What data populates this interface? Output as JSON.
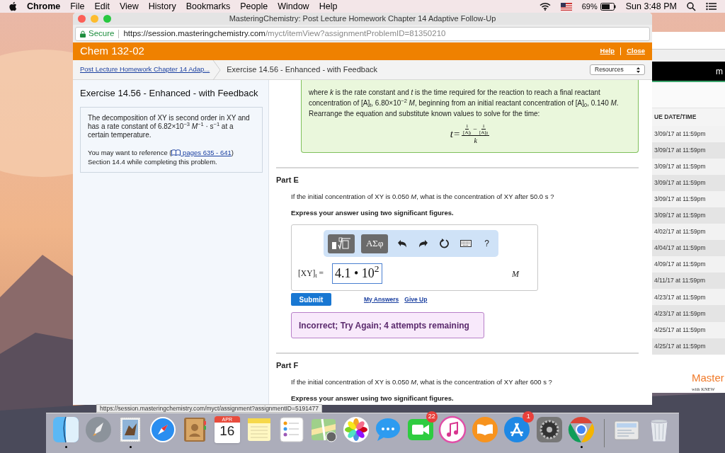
{
  "menu_bar": {
    "app": "Chrome",
    "menus": [
      "File",
      "Edit",
      "View",
      "History",
      "Bookmarks",
      "People",
      "Window",
      "Help"
    ],
    "battery": "69%",
    "clock": "Sun 3:48 PM"
  },
  "browser": {
    "title": "MasteringChemistry: Post Lecture Homework Chapter 14 Adaptive Follow-Up",
    "secure": "Secure",
    "url_host": "https://session.masteringchemistry.com",
    "url_path": "/myct/itemView?assignmentProblemID=81350210",
    "status_url": "https://session.masteringchemistry.com/myct/assignment?assignmentID=5191477"
  },
  "course_bar": {
    "title": "Chem 132-02",
    "links": [
      "Help",
      "Close"
    ]
  },
  "breadcrumb": {
    "parent": "Post Lecture Homework Chapter 14 Adap...",
    "current": "Exercise 14.56 - Enhanced - with Feedback",
    "resources": "Resources"
  },
  "sidebar": {
    "title": "Exercise 14.56 - Enhanced - with Feedback",
    "problem": "The decomposition of XY is second order in XY and has a rate constant of 6.82×10$^{−3}$ *M*$^{−1}$ · s$^{−1}$ at a certain temperature.",
    "reference_prefix": "You may want to reference (",
    "reference_link": "pages 635 - 641",
    "reference_suffix": ") Section 14.4 while completing this problem."
  },
  "hint": {
    "text": "where *k* is the rate constant and *t* is the time required for the reaction to reach a final reactant concentration of [A]$_{t}$, 6.80×10$^{−2}$ *M*, beginning from an initial reactant concentration of [A]$_{0}$, 0.140 *M*. Rearrange the equation and substitute known values to solve for the time:",
    "formula": {
      "lhs": "t=",
      "num1": "1",
      "den1": "[A]$_{t}$",
      "minus": "−",
      "num2": "1",
      "den2": "[A]$_{0}$",
      "den": "k"
    }
  },
  "parts": [
    {
      "title": "Part E",
      "question": "If the initial concentration of XY is 0.050 *M*, what is the concentration of XY after 50.0 s ?",
      "instruction": "Express your answer using two significant figures.",
      "answer": {
        "label": "[XY]$_{t}$ =",
        "value": "4.1 • 10$^{2}$",
        "unit": "M",
        "toolbar": [
          {
            "kind": "templates"
          },
          {
            "kind": "symbols",
            "label": "ΑΣφ"
          },
          {
            "kind": "undo"
          },
          {
            "kind": "redo"
          },
          {
            "kind": "reset"
          },
          {
            "kind": "keyboard"
          },
          {
            "kind": "help",
            "label": "?"
          }
        ]
      },
      "submit": "Submit",
      "links": [
        "My Answers",
        "Give Up"
      ],
      "feedback": "Incorrect; Try Again; 4 attempts remaining"
    },
    {
      "title": "Part F",
      "question": "If the initial concentration of XY is 0.050 *M*, what is the concentration of XY after 600 s ?",
      "instruction": "Express your answer using two significant figures."
    }
  ],
  "background_window": {
    "top_text": "m",
    "header": "UE DATE/TIME",
    "due_dates": [
      "3/09/17 at 11:59pm",
      "3/09/17 at 11:59pm",
      "3/09/17 at 11:59pm",
      "3/09/17 at 11:59pm",
      "3/09/17 at 11:59pm",
      "3/09/17 at 11:59pm",
      "4/02/17 at 11:59pm",
      "4/04/17 at 11:59pm",
      "4/09/17 at 11:59pm",
      "4/11/17 at 11:59pm",
      "4/23/17 at 11:59pm",
      "4/23/17 at 11:59pm",
      "4/25/17 at 11:59pm",
      "4/25/17 at 11:59pm"
    ],
    "brand": "Master",
    "brand_sub": "with KNEW"
  },
  "dock": {
    "items": [
      {
        "kind": "finder",
        "running": true
      },
      {
        "kind": "launchpad",
        "running": false
      },
      {
        "kind": "mail",
        "running": true
      },
      {
        "kind": "safari",
        "running": false
      },
      {
        "kind": "contacts",
        "running": false
      },
      {
        "kind": "calendar",
        "running": false,
        "month": "APR",
        "day": "16"
      },
      {
        "kind": "notes",
        "running": false
      },
      {
        "kind": "reminders",
        "running": false
      },
      {
        "kind": "maps",
        "running": false
      },
      {
        "kind": "photos",
        "running": false
      },
      {
        "kind": "messages",
        "running": false
      },
      {
        "kind": "facetime",
        "running": false,
        "badge": "22"
      },
      {
        "kind": "itunes",
        "running": false
      },
      {
        "kind": "ibooks",
        "running": false
      },
      {
        "kind": "appstore",
        "running": false,
        "badge": "1"
      },
      {
        "kind": "preferences",
        "running": false
      },
      {
        "kind": "chrome",
        "running": true
      },
      {
        "kind": "separator"
      },
      {
        "kind": "downloads",
        "running": false
      },
      {
        "kind": "trash",
        "running": false
      }
    ]
  }
}
